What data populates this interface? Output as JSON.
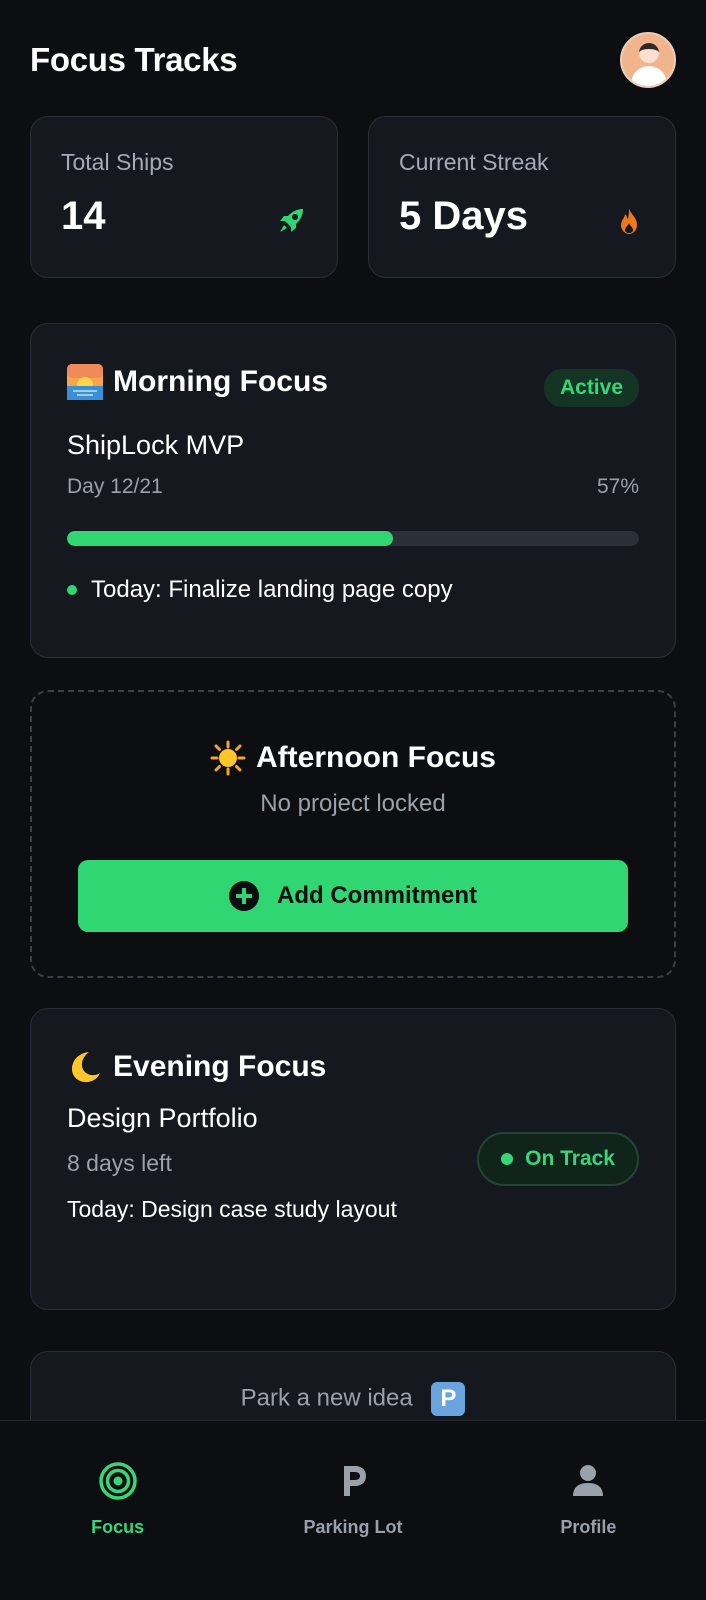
{
  "header": {
    "title": "Focus Tracks",
    "avatar": "user-avatar"
  },
  "stats": [
    {
      "label": "Total Ships",
      "value": "14",
      "icon": "rocket-icon",
      "icon_color": "#2fd672"
    },
    {
      "label": "Current Streak",
      "value": "5 Days",
      "icon": "flame-icon",
      "icon_color": "#f07a1a"
    }
  ],
  "morning": {
    "title": "Morning Focus",
    "icon": "sunrise-emoji",
    "badge": "Active",
    "project": "ShipLock MVP",
    "day": "Day 12/21",
    "percent_label": "57%",
    "progress": 0.57,
    "today": "Today: Finalize landing page copy"
  },
  "afternoon": {
    "title": "Afternoon Focus",
    "icon": "sun-emoji",
    "subtitle": "No project locked",
    "button_label": "Add Commitment"
  },
  "evening": {
    "title": "Evening Focus",
    "icon": "crescent-moon-emoji",
    "project": "Design Portfolio",
    "days_left": "8 days left",
    "today": "Today: Design case study layout",
    "badge": "On Track"
  },
  "park": {
    "label": "Park a new idea",
    "icon": "parking-emoji",
    "icon_letter": "P"
  },
  "nav": [
    {
      "label": "Focus",
      "icon": "target-icon",
      "active": true
    },
    {
      "label": "Parking Lot",
      "icon": "parking-icon",
      "active": false
    },
    {
      "label": "Profile",
      "icon": "person-icon",
      "active": false
    }
  ],
  "colors": {
    "accent": "#2fd672",
    "background": "#0c0e12",
    "card": "#15181e",
    "streak": "#f07a1a"
  }
}
